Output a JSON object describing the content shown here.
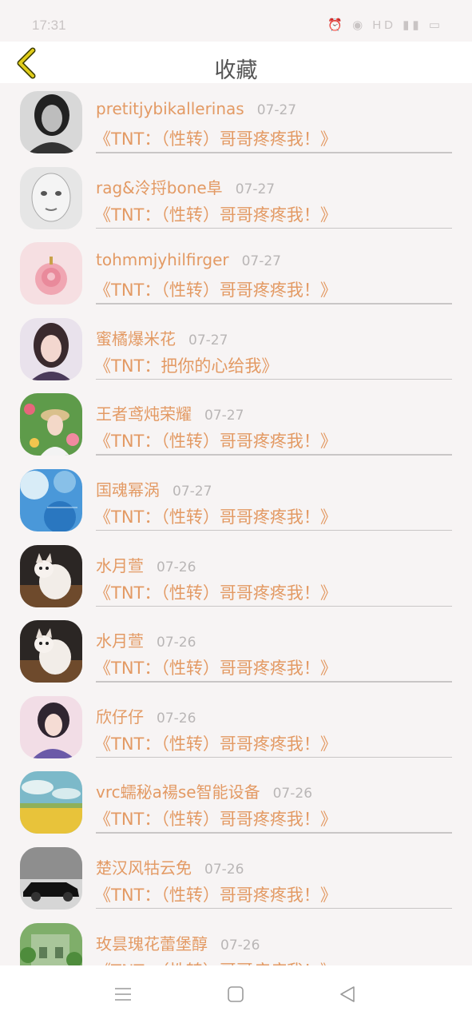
{
  "status": {
    "time": "17:31",
    "indicators": "⏰ ◉ HD ▮▮ ▭"
  },
  "header": {
    "title": "收藏",
    "back_icon": "chevron-left-icon"
  },
  "colors": {
    "accent": "#e39a64",
    "back_icon": "#d4c20a"
  },
  "favorites": [
    {
      "name": "pretitjybikallerinas",
      "date": "07-27",
      "title": "《TNT：（性转）哥哥疼疼我！》",
      "avatar": "portrait-bw"
    },
    {
      "name": "rag&泠捋bone阜",
      "date": "07-27",
      "title": "《TNT：（性转）哥哥疼疼我！》",
      "avatar": "mime-face"
    },
    {
      "name": "tohmmjyhilfirger",
      "date": "07-27",
      "title": "《TNT：（性转）哥哥疼疼我！》",
      "avatar": "pink-rose"
    },
    {
      "name": "蜜橘爆米花",
      "date": "07-27",
      "title": "《TNT：把你的心给我》",
      "avatar": "girl-portrait"
    },
    {
      "name": "王者鸢炖荣耀",
      "date": "07-27",
      "title": "《TNT：（性转）哥哥疼疼我！》",
      "avatar": "girl-flowers"
    },
    {
      "name": "国魂幂涡",
      "date": "07-27",
      "title": "《TNT：（性转）哥哥疼疼我！》",
      "avatar": "blue-balloons"
    },
    {
      "name": "水月萱",
      "date": "07-26",
      "title": "《TNT：（性转）哥哥疼疼我！》",
      "avatar": "kitten"
    },
    {
      "name": "水月萱",
      "date": "07-26",
      "title": "《TNT：（性转）哥哥疼疼我！》",
      "avatar": "kitten"
    },
    {
      "name": "欣仔仔",
      "date": "07-26",
      "title": "《TNT：（性转）哥哥疼疼我！》",
      "avatar": "girl-pink"
    },
    {
      "name": "vrc蠕秘a禓se智能设备",
      "date": "07-26",
      "title": "《TNT：（性转）哥哥疼疼我！》",
      "avatar": "field-sky"
    },
    {
      "name": "楚汉风牯云免",
      "date": "07-26",
      "title": "《TNT：（性转）哥哥疼疼我！》",
      "avatar": "black-car"
    },
    {
      "name": "玫昙瑰花蕾堡醇",
      "date": "07-26",
      "title": "《TNT：（性转）哥哥疼疼我！》",
      "avatar": "green-garden"
    }
  ],
  "nav": {
    "menu": "menu-icon",
    "home": "home-square-icon",
    "back": "back-triangle-icon"
  }
}
